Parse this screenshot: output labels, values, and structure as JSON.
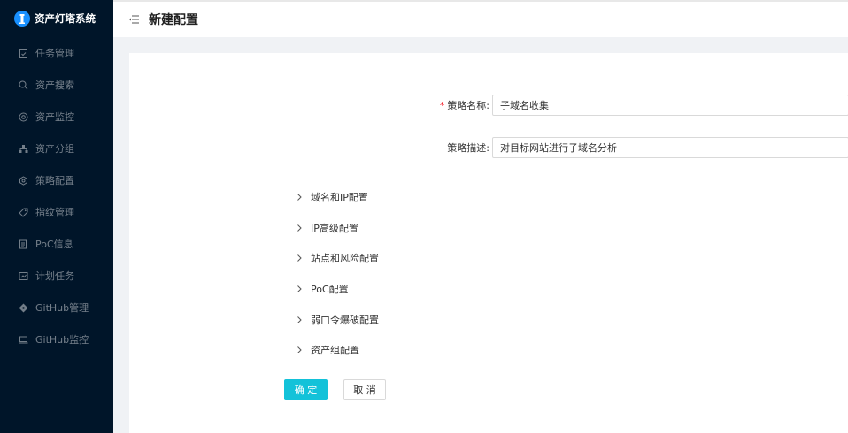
{
  "app": {
    "title": "资产灯塔系统"
  },
  "sidebar": {
    "items": [
      {
        "label": "任务管理",
        "icon": "clipboard-icon"
      },
      {
        "label": "资产搜索",
        "icon": "search-icon"
      },
      {
        "label": "资产监控",
        "icon": "monitor-icon"
      },
      {
        "label": "资产分组",
        "icon": "cluster-icon"
      },
      {
        "label": "策略配置",
        "icon": "gear-icon"
      },
      {
        "label": "指纹管理",
        "icon": "tag-icon"
      },
      {
        "label": "PoC信息",
        "icon": "file-icon"
      },
      {
        "label": "计划任务",
        "icon": "schedule-icon"
      },
      {
        "label": "GitHub管理",
        "icon": "github-icon"
      },
      {
        "label": "GitHub监控",
        "icon": "laptop-icon"
      }
    ]
  },
  "header": {
    "title": "新建配置"
  },
  "form": {
    "name_label": "策略名称:",
    "name_value": "子域名收集",
    "desc_label": "策略描述:",
    "desc_value": "对目标网站进行子域名分析",
    "sections": [
      "域名和IP配置",
      "IP高级配置",
      "站点和风险配置",
      "PoC配置",
      "弱口令爆破配置",
      "资产组配置"
    ],
    "confirm_label": "确 定",
    "cancel_label": "取 消"
  },
  "colors": {
    "sidebar_bg": "#001529",
    "primary": "#13c2d9",
    "required": "#f5222d"
  }
}
